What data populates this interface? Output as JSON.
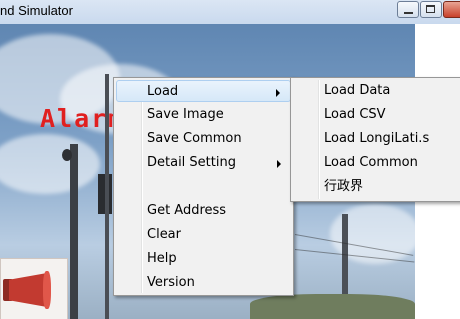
{
  "window": {
    "title": "nd Simulator"
  },
  "overlay_text": "Alarm",
  "context_menu": {
    "items": [
      {
        "label": "Load",
        "has_submenu": true,
        "highlighted": true
      },
      {
        "label": "Save Image",
        "has_submenu": false
      },
      {
        "label": "Save Common",
        "has_submenu": false
      },
      {
        "label": "Detail Setting",
        "has_submenu": true
      },
      {
        "label": "Get Address",
        "has_submenu": false
      },
      {
        "label": "Clear",
        "has_submenu": false
      },
      {
        "label": "Help",
        "has_submenu": false
      },
      {
        "label": "Version",
        "has_submenu": false
      }
    ]
  },
  "load_submenu": {
    "items": [
      {
        "label": "Load Data"
      },
      {
        "label": "Load CSV"
      },
      {
        "label": "Load LongiLati.s"
      },
      {
        "label": "Load Common"
      },
      {
        "label": "行政界"
      }
    ]
  },
  "icons": {
    "minimize": "minimize-icon",
    "maximize": "maximize-icon",
    "close": "close-icon",
    "submenu_arrow": "chevron-right-icon"
  },
  "colors": {
    "menu_background": "#f1f1f1",
    "highlight": "#d6e8f8",
    "overlay_text": "#e02020"
  }
}
